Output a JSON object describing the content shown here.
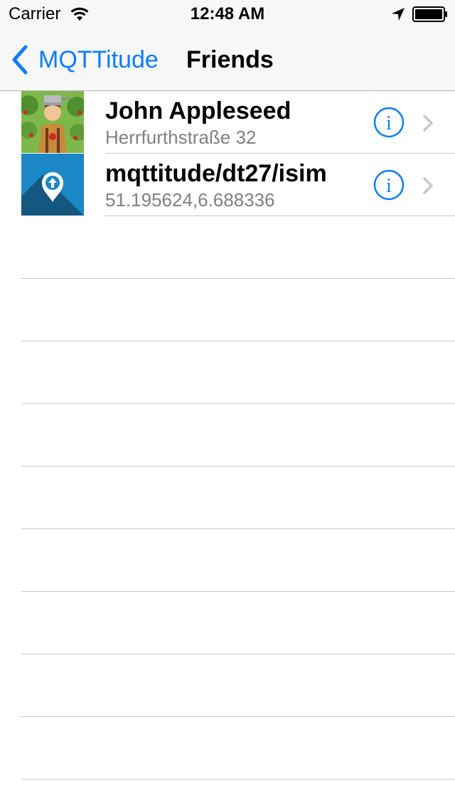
{
  "status_bar": {
    "carrier": "Carrier",
    "time": "12:48 AM",
    "wifi_icon": "wifi-icon",
    "location_icon": "location-arrow-icon",
    "battery_icon": "battery-full-icon"
  },
  "nav": {
    "back_label": "MQTTitude",
    "title": "Friends",
    "accent_color": "#0b7cff"
  },
  "friends": [
    {
      "name": "John Appleseed",
      "detail": "Herrfurthstraße 32",
      "avatar": "john-appleseed-photo"
    },
    {
      "name": "mqttitude/dt27/isim",
      "detail": "51.195624,6.688336",
      "avatar": "mqttitude-logo"
    }
  ]
}
